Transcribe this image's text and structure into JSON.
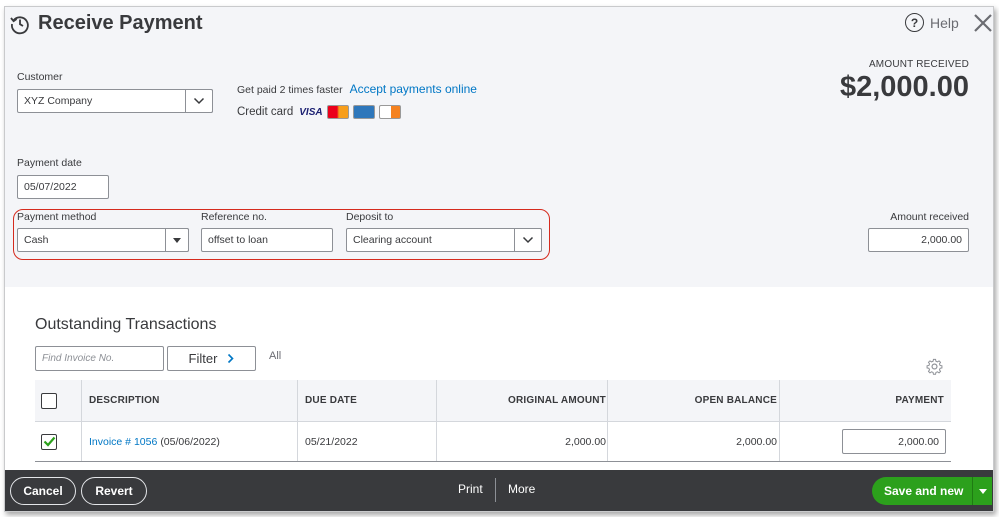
{
  "header": {
    "title": "Receive Payment",
    "help_label": "Help"
  },
  "customer": {
    "label": "Customer",
    "value": "XYZ Company"
  },
  "promo": {
    "get_paid_text": "Get paid 2 times faster",
    "accept_link": "Accept payments online",
    "credit_card_label": "Credit card",
    "visa_text": "VISA"
  },
  "amount_received_header": {
    "label": "AMOUNT RECEIVED",
    "value": "$2,000.00"
  },
  "payment_date": {
    "label": "Payment date",
    "value": "05/07/2022"
  },
  "payment_method": {
    "label": "Payment method",
    "value": "Cash"
  },
  "reference_no": {
    "label": "Reference no.",
    "value": "offset to loan"
  },
  "deposit_to": {
    "label": "Deposit to",
    "value": "Clearing account"
  },
  "amount_received_field": {
    "label": "Amount received",
    "value": "2,000.00"
  },
  "outstanding": {
    "title": "Outstanding Transactions",
    "find_placeholder": "Find Invoice No.",
    "filter_label": "Filter",
    "all_label": "All",
    "columns": [
      "DESCRIPTION",
      "DUE DATE",
      "ORIGINAL AMOUNT",
      "OPEN BALANCE",
      "PAYMENT"
    ],
    "rows": [
      {
        "checked": true,
        "invoice_link": "Invoice # 1056",
        "invoice_date": "(05/06/2022)",
        "due_date": "05/21/2022",
        "original_amount": "2,000.00",
        "open_balance": "2,000.00",
        "payment": "2,000.00"
      }
    ]
  },
  "footer": {
    "cancel": "Cancel",
    "revert": "Revert",
    "print": "Print",
    "more": "More",
    "save_and_new": "Save and new"
  },
  "colors": {
    "accent_green": "#2ca01c",
    "link_blue": "#0077c5",
    "footer_bg": "#393a3d",
    "highlight_red": "#d52b1e"
  }
}
